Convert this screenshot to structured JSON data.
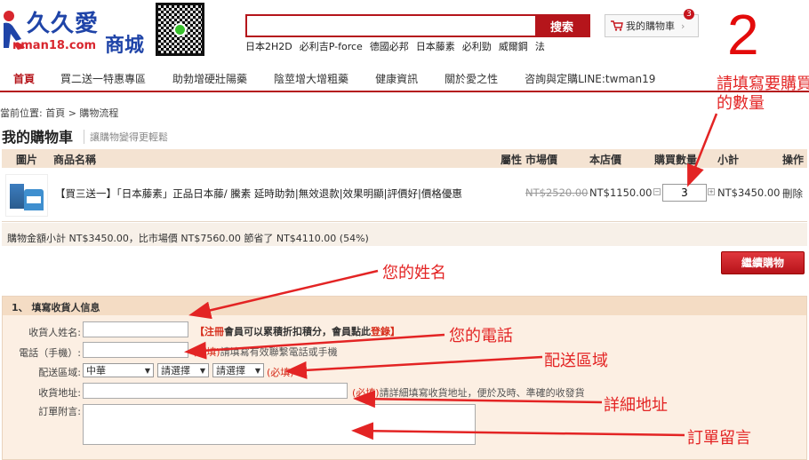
{
  "header": {
    "logo_text": "久久愛",
    "logo_url": "nman18.com",
    "logo_mall": "商城",
    "search_button": "搜索",
    "hotwords": [
      "日本2H2D",
      "必利吉P-force",
      "德國必邦",
      "日本藤素",
      "必利勁",
      "威爾鋼",
      "法"
    ],
    "cart_label": "我的購物車",
    "cart_count": "3"
  },
  "step_number": "2",
  "nav": [
    "首頁",
    "買二送一特惠專區",
    "助勃增硬壯陽藥",
    "陰莖增大增粗藥",
    "健康資訊",
    "關於愛之性",
    "咨詢與定購LINE:twman19"
  ],
  "breadcrumb": "當前位置: 首頁 > 購物流程",
  "cart": {
    "title": "我的購物車",
    "subtitle": "讓購物變得更輕鬆",
    "columns": {
      "image": "圖片",
      "name": "商品名稱",
      "attr": "屬性",
      "market": "市場價",
      "shop": "本店價",
      "qty": "購買數量",
      "subtotal": "小計",
      "action": "操作"
    },
    "items": [
      {
        "name": "【買三送一】「日本藤素」正品日本藤/ 騰素 延時助勃|無效退款|效果明顯|評價好|價格優惠",
        "market_price": "NT$2520.00",
        "shop_price": "NT$1150.00",
        "qty": "3",
        "subtotal": "NT$3450.00",
        "delete": "刪除"
      }
    ],
    "summary": "購物金額小計 NT$3450.00，比市場價 NT$7560.00 節省了 NT$4110.00 (54%)",
    "continue_button": "繼續購物"
  },
  "form": {
    "heading": "1、 填寫收貨人信息",
    "name_label": "收貨人姓名:",
    "name_hint_bracket_open": "【",
    "name_hint_register": "注冊",
    "name_hint_mid": "會員可以累積折扣積分，會員點此",
    "name_hint_login": "登錄",
    "name_hint_bracket_close": "】",
    "phone_label": "電話（手機）:",
    "phone_required": "(必填)",
    "phone_hint": "請填寫有效聯繫電話或手機",
    "region_label": "配送區域:",
    "region_country": "中華",
    "region_province": "請選擇",
    "region_city": "請選擇",
    "region_required": "(必填)",
    "address_label": "收貨地址:",
    "address_required": "(必填)",
    "address_hint": "請詳細填寫收貨地址，便於及時、準確的收發貨",
    "note_label": "訂單附言:"
  },
  "annotations": {
    "qty": "請填寫要購買\n的數量",
    "name": "您的姓名",
    "phone": "您的電話",
    "region": "配送區域",
    "address": "詳細地址",
    "note": "訂單留言"
  },
  "colors": {
    "brand_red": "#b5151b",
    "annotation_red": "#e32424",
    "header_bg": "#f4e3d2",
    "form_bg": "#fcefe3"
  }
}
